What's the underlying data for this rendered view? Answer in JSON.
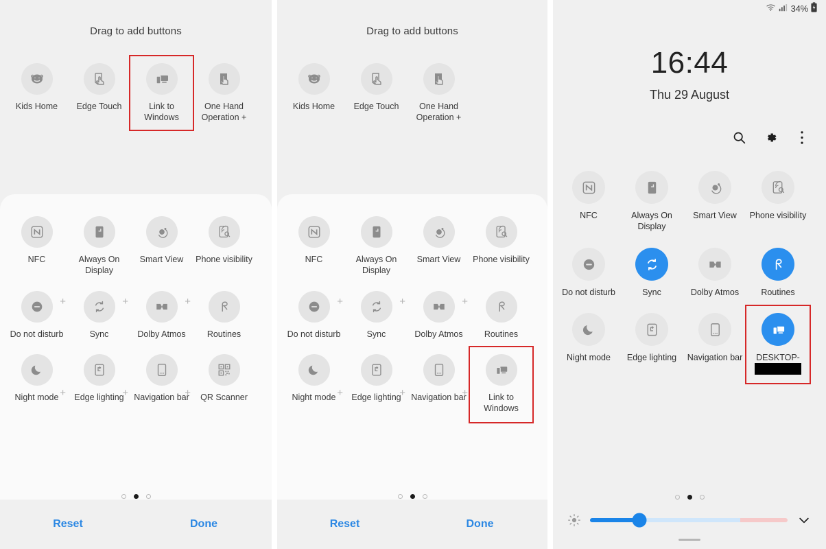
{
  "panels": {
    "editor_left": {
      "drag_title": "Drag to add buttons",
      "available": [
        {
          "label": "Kids Home",
          "icon": "kids-home-icon",
          "highlighted": false
        },
        {
          "label": "Edge Touch",
          "icon": "edge-touch-icon",
          "highlighted": false
        },
        {
          "label": "Link to Windows",
          "icon": "link-to-windows-icon",
          "highlighted": true
        },
        {
          "label": "One Hand Operation +",
          "icon": "one-hand-operation-icon",
          "highlighted": false
        }
      ],
      "grid": [
        [
          {
            "label": "NFC",
            "icon": "nfc-icon"
          },
          {
            "label": "Always On Display",
            "icon": "always-on-display-icon"
          },
          {
            "label": "Smart View",
            "icon": "smart-view-icon"
          },
          {
            "label": "Phone visibility",
            "icon": "phone-visibility-icon"
          }
        ],
        [
          {
            "label": "Do not disturb",
            "icon": "do-not-disturb-icon"
          },
          {
            "label": "Sync",
            "icon": "sync-icon"
          },
          {
            "label": "Dolby Atmos",
            "icon": "dolby-atmos-icon"
          },
          {
            "label": "Routines",
            "icon": "routines-icon"
          }
        ],
        [
          {
            "label": "Night mode",
            "icon": "night-mode-icon"
          },
          {
            "label": "Edge lighting",
            "icon": "edge-lighting-icon"
          },
          {
            "label": "Navigation bar",
            "icon": "navigation-bar-icon"
          },
          {
            "label": "QR Scanner",
            "icon": "qr-scanner-icon"
          }
        ]
      ],
      "plus_label": "+",
      "page_dots": {
        "count": 3,
        "active_index": 1
      },
      "reset_label": "Reset",
      "done_label": "Done"
    },
    "editor_right": {
      "drag_title": "Drag to add buttons",
      "available": [
        {
          "label": "Kids Home",
          "icon": "kids-home-icon",
          "highlighted": false
        },
        {
          "label": "Edge Touch",
          "icon": "edge-touch-icon",
          "highlighted": false
        },
        {
          "label": "One Hand Operation +",
          "icon": "one-hand-operation-icon",
          "highlighted": false
        }
      ],
      "grid": [
        [
          {
            "label": "NFC",
            "icon": "nfc-icon"
          },
          {
            "label": "Always On Display",
            "icon": "always-on-display-icon"
          },
          {
            "label": "Smart View",
            "icon": "smart-view-icon"
          },
          {
            "label": "Phone visibility",
            "icon": "phone-visibility-icon"
          }
        ],
        [
          {
            "label": "Do not disturb",
            "icon": "do-not-disturb-icon"
          },
          {
            "label": "Sync",
            "icon": "sync-icon"
          },
          {
            "label": "Dolby Atmos",
            "icon": "dolby-atmos-icon"
          },
          {
            "label": "Routines",
            "icon": "routines-icon"
          }
        ],
        [
          {
            "label": "Night mode",
            "icon": "night-mode-icon"
          },
          {
            "label": "Edge lighting",
            "icon": "edge-lighting-icon"
          },
          {
            "label": "Navigation bar",
            "icon": "navigation-bar-icon"
          },
          {
            "label": "Link to Windows",
            "icon": "link-to-windows-icon",
            "highlighted": true
          }
        ]
      ],
      "plus_label": "+",
      "page_dots": {
        "count": 3,
        "active_index": 1
      },
      "reset_label": "Reset",
      "done_label": "Done"
    },
    "quick_panel": {
      "status": {
        "wifi_icon": "wifi-icon",
        "signal_icon": "signal-bars-icon",
        "battery_percent": "34%",
        "battery_icon": "battery-charging-icon"
      },
      "clock": {
        "time": "16:44",
        "date": "Thu 29 August"
      },
      "actions": [
        {
          "name": "search-icon",
          "label": "Search"
        },
        {
          "name": "gear-icon",
          "label": "Settings"
        },
        {
          "name": "more-options-icon",
          "label": "More options"
        }
      ],
      "grid": [
        [
          {
            "label": "NFC",
            "icon": "nfc-icon",
            "on": false
          },
          {
            "label": "Always On Display",
            "icon": "always-on-display-icon",
            "on": false
          },
          {
            "label": "Smart View",
            "icon": "smart-view-icon",
            "on": false
          },
          {
            "label": "Phone visibility",
            "icon": "phone-visibility-icon",
            "on": false
          }
        ],
        [
          {
            "label": "Do not disturb",
            "icon": "do-not-disturb-icon",
            "on": false
          },
          {
            "label": "Sync",
            "icon": "sync-icon",
            "on": true
          },
          {
            "label": "Dolby Atmos",
            "icon": "dolby-atmos-icon",
            "on": false
          },
          {
            "label": "Routines",
            "icon": "routines-icon",
            "on": true
          }
        ],
        [
          {
            "label": "Night mode",
            "icon": "night-mode-icon",
            "on": false
          },
          {
            "label": "Edge lighting",
            "icon": "edge-lighting-icon",
            "on": false
          },
          {
            "label": "Navigation bar",
            "icon": "navigation-bar-icon",
            "on": false
          },
          {
            "label": "DESKTOP-",
            "icon": "link-to-windows-icon",
            "on": true,
            "highlighted": true,
            "redacted": true
          }
        ]
      ],
      "page_dots": {
        "count": 3,
        "active_index": 1
      },
      "brightness": {
        "icon": "brightness-icon",
        "value_percent": 25,
        "expand_icon": "chevron-down-icon"
      }
    }
  },
  "colors": {
    "accent_blue": "#2b8fee",
    "link_blue": "#2b87e3",
    "highlight_red": "#d62828",
    "tile_off": "#e4e4e4",
    "panel_bg": "#f0f0f0",
    "sheet_bg": "#fafafa"
  }
}
